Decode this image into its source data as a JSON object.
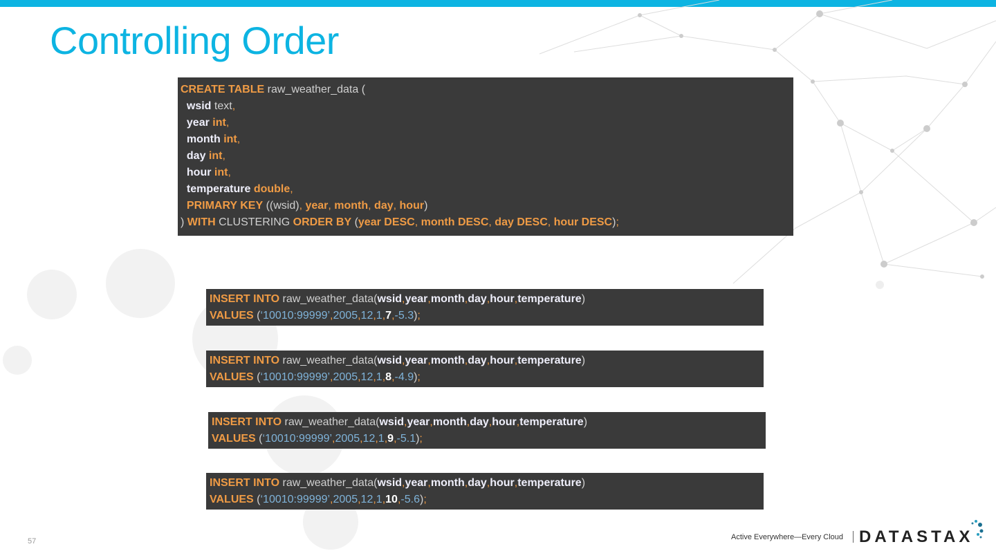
{
  "slide": {
    "title": "Controlling Order",
    "page_number": "57",
    "footer_tagline": "Active Everywhere—Every Cloud",
    "logo_text": "DATASTAX",
    "accent_color": "#0db4e2"
  },
  "create_block": [
    [
      [
        "CREATE TABLE",
        "k"
      ],
      [
        " raw_weather_data (",
        "p"
      ]
    ],
    [
      [
        "  wsid",
        "w"
      ],
      [
        " text",
        "p"
      ],
      [
        ",",
        "o"
      ]
    ],
    [
      [
        "  year",
        "w"
      ],
      [
        " int",
        "k"
      ],
      [
        ",",
        "o"
      ]
    ],
    [
      [
        "  month",
        "w"
      ],
      [
        " int",
        "k"
      ],
      [
        ",",
        "o"
      ]
    ],
    [
      [
        "  day",
        "w"
      ],
      [
        " int",
        "k"
      ],
      [
        ",",
        "o"
      ]
    ],
    [
      [
        "  hour",
        "w"
      ],
      [
        " int",
        "k"
      ],
      [
        ",",
        "o"
      ]
    ],
    [
      [
        "  temperature",
        "w"
      ],
      [
        " double",
        "k"
      ],
      [
        ",",
        "o"
      ]
    ],
    [
      [
        "  PRIMARY KEY",
        "k"
      ],
      [
        " ((wsid)",
        "p"
      ],
      [
        ", ",
        "o"
      ],
      [
        "year",
        "k"
      ],
      [
        ", ",
        "o"
      ],
      [
        "month",
        "k"
      ],
      [
        ", ",
        "o"
      ],
      [
        "day",
        "k"
      ],
      [
        ", ",
        "o"
      ],
      [
        "hour",
        "k"
      ],
      [
        ")",
        "p"
      ]
    ],
    [
      [
        ") ",
        "p"
      ],
      [
        "WITH",
        "k"
      ],
      [
        " CLUSTERING ",
        "p"
      ],
      [
        "ORDER BY",
        "k"
      ],
      [
        " (",
        "p"
      ],
      [
        "year DESC",
        "k"
      ],
      [
        ", ",
        "o"
      ],
      [
        "month DESC",
        "k"
      ],
      [
        ", ",
        "o"
      ],
      [
        "day DESC",
        "k"
      ],
      [
        ", ",
        "o"
      ],
      [
        "hour DESC",
        "k"
      ],
      [
        ")",
        "p"
      ],
      [
        ";",
        "o"
      ]
    ]
  ],
  "insert_blocks": [
    [
      [
        [
          "INSERT INTO",
          "k"
        ],
        [
          " raw_weather_data(",
          "p"
        ],
        [
          "wsid",
          "w"
        ],
        [
          ",",
          "o"
        ],
        [
          "year",
          "w"
        ],
        [
          ",",
          "o"
        ],
        [
          "month",
          "w"
        ],
        [
          ",",
          "o"
        ],
        [
          "day",
          "w"
        ],
        [
          ",",
          "o"
        ],
        [
          "hour",
          "w"
        ],
        [
          ",",
          "o"
        ],
        [
          "temperature",
          "w"
        ],
        [
          ")",
          "p"
        ]
      ],
      [
        [
          "VALUES",
          "k"
        ],
        [
          " (",
          "p"
        ],
        [
          "‘10010:99999’",
          "b"
        ],
        [
          ",",
          "o"
        ],
        [
          "2005",
          "b"
        ],
        [
          ",",
          "o"
        ],
        [
          "12",
          "b"
        ],
        [
          ",",
          "o"
        ],
        [
          "1",
          "b"
        ],
        [
          ",",
          "o"
        ],
        [
          "7",
          "n"
        ],
        [
          ",",
          "o"
        ],
        [
          "-5.3",
          "b"
        ],
        [
          ")",
          "p"
        ],
        [
          ";",
          "o"
        ]
      ]
    ],
    [
      [
        [
          "INSERT INTO",
          "k"
        ],
        [
          " raw_weather_data(",
          "p"
        ],
        [
          "wsid",
          "w"
        ],
        [
          ",",
          "o"
        ],
        [
          "year",
          "w"
        ],
        [
          ",",
          "o"
        ],
        [
          "month",
          "w"
        ],
        [
          ",",
          "o"
        ],
        [
          "day",
          "w"
        ],
        [
          ",",
          "o"
        ],
        [
          "hour",
          "w"
        ],
        [
          ",",
          "o"
        ],
        [
          "temperature",
          "w"
        ],
        [
          ")",
          "p"
        ]
      ],
      [
        [
          "VALUES",
          "k"
        ],
        [
          " (",
          "p"
        ],
        [
          "‘10010:99999’",
          "b"
        ],
        [
          ",",
          "o"
        ],
        [
          "2005",
          "b"
        ],
        [
          ",",
          "o"
        ],
        [
          "12",
          "b"
        ],
        [
          ",",
          "o"
        ],
        [
          "1",
          "b"
        ],
        [
          ",",
          "o"
        ],
        [
          "8",
          "n"
        ],
        [
          ",",
          "o"
        ],
        [
          "-4.9",
          "b"
        ],
        [
          ")",
          "p"
        ],
        [
          ";",
          "o"
        ]
      ]
    ],
    [
      [
        [
          "INSERT INTO",
          "k"
        ],
        [
          " raw_weather_data(",
          "p"
        ],
        [
          "wsid",
          "w"
        ],
        [
          ",",
          "o"
        ],
        [
          "year",
          "w"
        ],
        [
          ",",
          "o"
        ],
        [
          "month",
          "w"
        ],
        [
          ",",
          "o"
        ],
        [
          "day",
          "w"
        ],
        [
          ",",
          "o"
        ],
        [
          "hour",
          "w"
        ],
        [
          ",",
          "o"
        ],
        [
          "temperature",
          "w"
        ],
        [
          ")",
          "p"
        ]
      ],
      [
        [
          "VALUES",
          "k"
        ],
        [
          " (",
          "p"
        ],
        [
          "‘10010:99999’",
          "b"
        ],
        [
          ",",
          "o"
        ],
        [
          "2005",
          "b"
        ],
        [
          ",",
          "o"
        ],
        [
          "12",
          "b"
        ],
        [
          ",",
          "o"
        ],
        [
          "1",
          "b"
        ],
        [
          ",",
          "o"
        ],
        [
          "9",
          "n"
        ],
        [
          ",",
          "o"
        ],
        [
          "-5.1",
          "b"
        ],
        [
          ")",
          "p"
        ],
        [
          ";",
          "o"
        ]
      ]
    ],
    [
      [
        [
          "INSERT INTO",
          "k"
        ],
        [
          " raw_weather_data(",
          "p"
        ],
        [
          "wsid",
          "w"
        ],
        [
          ",",
          "o"
        ],
        [
          "year",
          "w"
        ],
        [
          ",",
          "o"
        ],
        [
          "month",
          "w"
        ],
        [
          ",",
          "o"
        ],
        [
          "day",
          "w"
        ],
        [
          ",",
          "o"
        ],
        [
          "hour",
          "w"
        ],
        [
          ",",
          "o"
        ],
        [
          "temperature",
          "w"
        ],
        [
          ")",
          "p"
        ]
      ],
      [
        [
          "VALUES",
          "k"
        ],
        [
          " (",
          "p"
        ],
        [
          "‘10010:99999’",
          "b"
        ],
        [
          ",",
          "o"
        ],
        [
          "2005",
          "b"
        ],
        [
          ",",
          "o"
        ],
        [
          "12",
          "b"
        ],
        [
          ",",
          "o"
        ],
        [
          "1",
          "b"
        ],
        [
          ",",
          "o"
        ],
        [
          "10",
          "n"
        ],
        [
          ",",
          "o"
        ],
        [
          "-5.6",
          "b"
        ],
        [
          ")",
          "p"
        ],
        [
          ";",
          "o"
        ]
      ]
    ]
  ]
}
